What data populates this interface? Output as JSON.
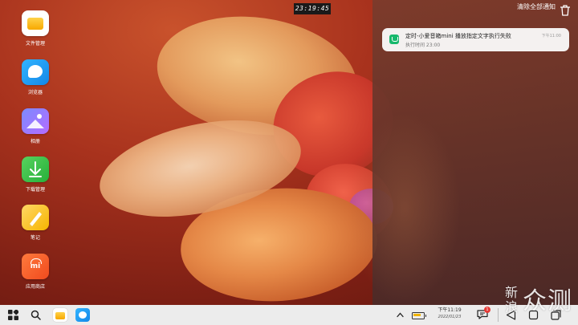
{
  "clock": {
    "time": "23:19:45"
  },
  "desktop": {
    "icons": [
      {
        "label": "文件管理",
        "icon": "files-icon"
      },
      {
        "label": "浏览器",
        "icon": "browser-icon"
      },
      {
        "label": "相册",
        "icon": "photos-icon"
      },
      {
        "label": "下载管理",
        "icon": "download-icon"
      },
      {
        "label": "笔记",
        "icon": "notes-icon"
      },
      {
        "label": "应用商店",
        "icon": "app-store-icon",
        "glyph": "mi"
      }
    ]
  },
  "notifications": {
    "clear_all_label": "清除全部通知",
    "items": [
      {
        "app_icon": "xiaoai-icon",
        "title": "定时-小爱音箱mini 播放指定文字执行失败",
        "subtitle": "执行时间 23:00",
        "time": "下午11:00"
      }
    ]
  },
  "taskbar": {
    "pinned": [
      "files-icon",
      "browser-icon"
    ],
    "clock_time": "下午11:19",
    "clock_date": "2022/01/23",
    "message_badge": "1"
  },
  "watermark": {
    "small_text": "新浪",
    "big_text": "众测"
  },
  "colors": {
    "accent_green": "#17b86c",
    "badge_red": "#e53935",
    "battery_yellow": "#f1b400"
  }
}
